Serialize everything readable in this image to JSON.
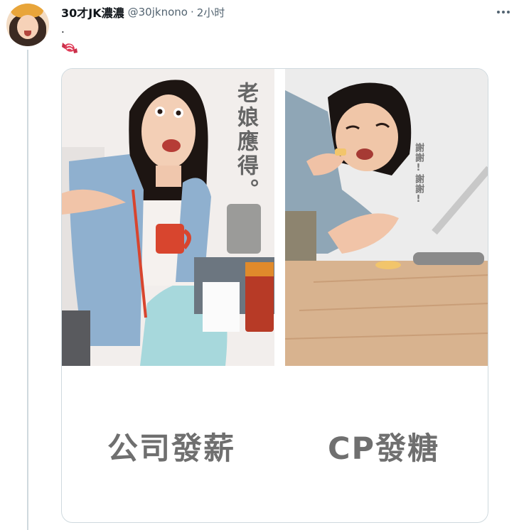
{
  "author": {
    "display_name": "30才JK濃濃",
    "handle": "@30jknono",
    "separator": "·",
    "time": "2小时"
  },
  "tweet": {
    "text": "."
  },
  "icons": {
    "avatar": "avatar-photo",
    "candy": "candy-icon",
    "more": "more-dots-icon"
  },
  "media": {
    "left_overlay_text": "老娘應得。",
    "right_overlay_text": "謝謝!謝謝!",
    "left_caption": "公司發薪",
    "right_caption": "CP發糖"
  },
  "colors": {
    "text_primary": "#0f1419",
    "text_secondary": "#536471",
    "border": "#cfd9de",
    "caption_gray": "#6f6f6f",
    "jacket_blue": "#8fb0cf",
    "mug_red": "#d8452e"
  }
}
